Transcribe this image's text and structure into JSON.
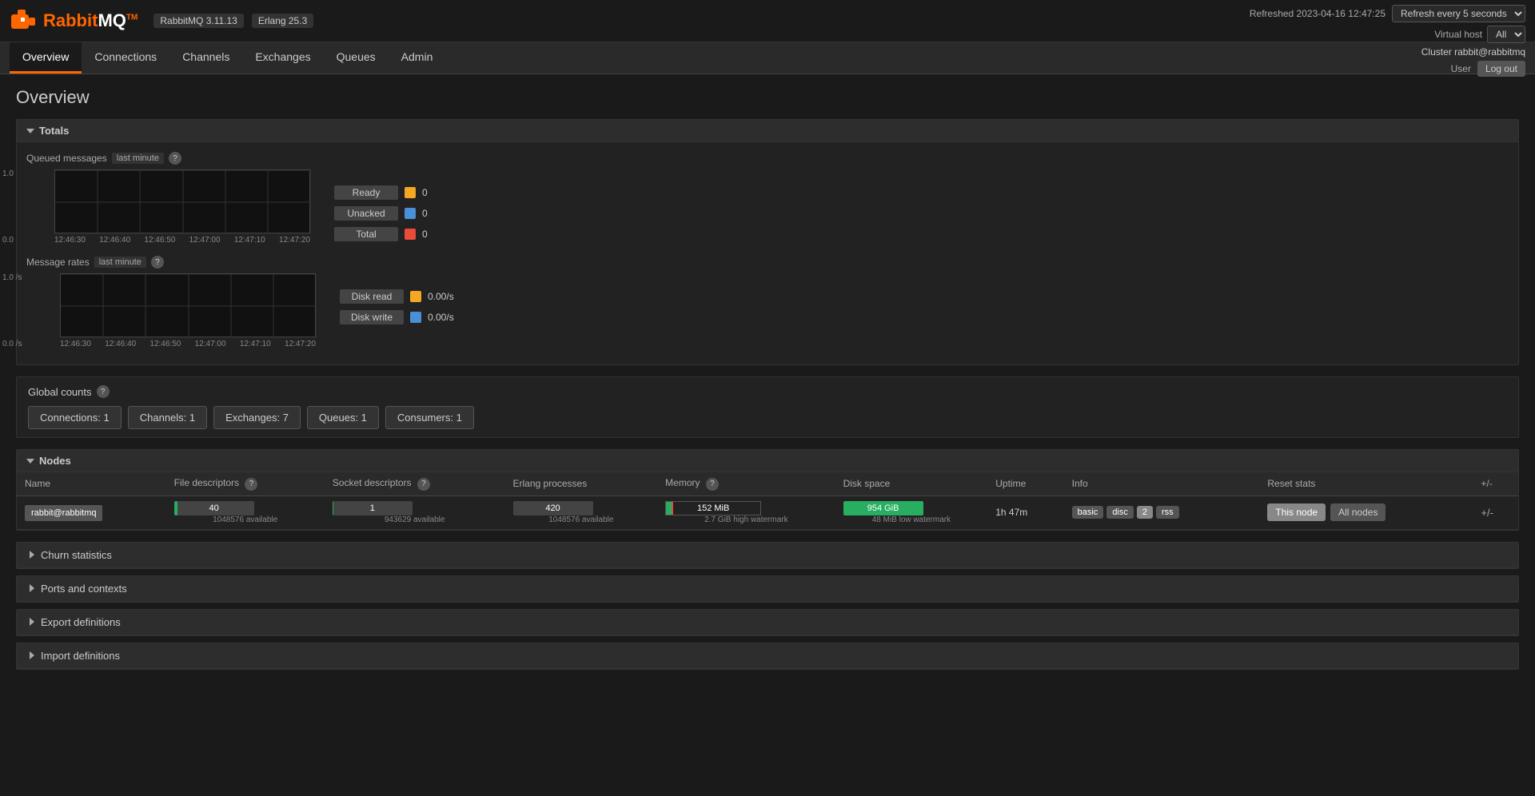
{
  "header": {
    "logo_rabbit": "Rabbit",
    "logo_mq": "MQ",
    "logo_tm": "TM",
    "version": "RabbitMQ 3.11.13",
    "erlang": "Erlang 25.3",
    "refreshed": "Refreshed 2023-04-16 12:47:25",
    "refresh_label": "Refresh every 5 seconds",
    "virtual_host_label": "Virtual host",
    "virtual_host_value": "All",
    "cluster_label": "Cluster",
    "cluster_value": "rabbit@rabbitmq",
    "user_label": "User",
    "logout_label": "Log out"
  },
  "nav": {
    "items": [
      {
        "label": "Overview",
        "active": true
      },
      {
        "label": "Connections",
        "active": false
      },
      {
        "label": "Channels",
        "active": false
      },
      {
        "label": "Exchanges",
        "active": false
      },
      {
        "label": "Queues",
        "active": false
      },
      {
        "label": "Admin",
        "active": false
      }
    ]
  },
  "page": {
    "title": "Overview"
  },
  "totals": {
    "section_label": "Totals",
    "queued_messages_label": "Queued messages",
    "time_range": "last minute",
    "chart_y_top": "1.0",
    "chart_y_bottom": "0.0",
    "chart_x_labels": [
      "12:46:30",
      "12:46:40",
      "12:46:50",
      "12:47:00",
      "12:47:10",
      "12:47:20"
    ],
    "legend": [
      {
        "label": "Ready",
        "color": "#f5a623",
        "value": "0"
      },
      {
        "label": "Unacked",
        "color": "#4a90d9",
        "value": "0"
      },
      {
        "label": "Total",
        "color": "#e74c3c",
        "value": "0"
      }
    ],
    "message_rates_label": "Message rates",
    "message_rates_range": "last minute",
    "rates_chart_y_top": "1.0 /s",
    "rates_chart_y_bottom": "0.0 /s",
    "rates_x_labels": [
      "12:46:30",
      "12:46:40",
      "12:46:50",
      "12:47:00",
      "12:47:10",
      "12:47:20"
    ],
    "rates_legend": [
      {
        "label": "Disk read",
        "color": "#f5a623",
        "value": "0.00/s"
      },
      {
        "label": "Disk write",
        "color": "#4a90d9",
        "value": "0.00/s"
      }
    ]
  },
  "global_counts": {
    "label": "Global counts",
    "buttons": [
      {
        "label": "Connections: 1"
      },
      {
        "label": "Channels: 1"
      },
      {
        "label": "Exchanges: 7"
      },
      {
        "label": "Queues: 1"
      },
      {
        "label": "Consumers: 1"
      }
    ]
  },
  "nodes": {
    "section_label": "Nodes",
    "columns": [
      "Name",
      "File descriptors",
      "Socket descriptors",
      "Erlang processes",
      "Memory",
      "Disk space",
      "Uptime",
      "Info",
      "Reset stats",
      "+/-"
    ],
    "rows": [
      {
        "name": "rabbit@rabbitmq",
        "file_descriptors": "40",
        "file_descriptors_available": "1048576 available",
        "socket_descriptors": "1",
        "socket_descriptors_available": "943629 available",
        "erlang_processes": "420",
        "erlang_processes_available": "1048576 available",
        "memory_value": "152 MiB",
        "memory_sub": "2.7 GiB high watermark",
        "disk_space": "954 GiB",
        "disk_sub": "48 MiB low watermark",
        "uptime": "1h 47m",
        "info_tags": [
          "basic",
          "disc",
          "2",
          "rss"
        ],
        "reset_this_node": "This node",
        "reset_all_nodes": "All nodes"
      }
    ]
  },
  "churn_statistics": {
    "label": "Churn statistics"
  },
  "ports_and_contexts": {
    "label": "Ports and contexts"
  },
  "export_definitions": {
    "label": "Export definitions"
  },
  "import_definitions": {
    "label": "Import definitions"
  }
}
